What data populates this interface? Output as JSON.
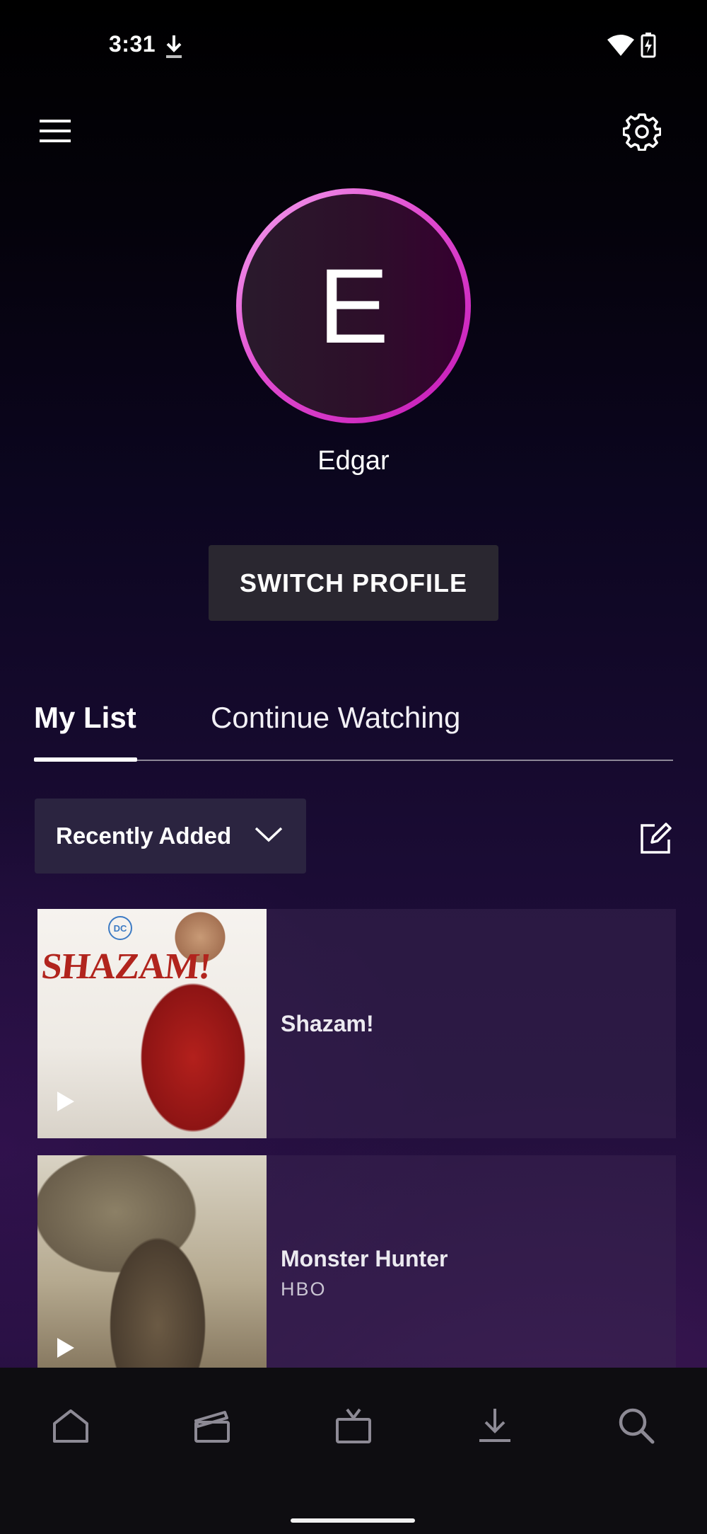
{
  "status_bar": {
    "time": "3:31",
    "icons": [
      "download-status-icon",
      "wifi-icon",
      "battery-charging-icon"
    ]
  },
  "header": {
    "menu_icon": "hamburger-menu-icon",
    "settings_icon": "gear-icon"
  },
  "profile": {
    "initial": "E",
    "name": "Edgar",
    "switch_button_label": "SWITCH PROFILE",
    "ring_color": "#e04cd0"
  },
  "tabs": [
    {
      "label": "My List",
      "active": true
    },
    {
      "label": "Continue Watching",
      "active": false
    }
  ],
  "sort": {
    "selected": "Recently Added",
    "icon": "chevron-down-icon"
  },
  "edit_icon": "edit-icon",
  "list_items": [
    {
      "title": "Shazam!",
      "subtitle": "",
      "poster_text": "SHAZAM!",
      "poster_logo": "DC"
    },
    {
      "title": "Monster Hunter",
      "subtitle": "HBO"
    }
  ],
  "bottom_nav": [
    {
      "name": "home",
      "icon": "home-icon"
    },
    {
      "name": "movies",
      "icon": "clapperboard-icon"
    },
    {
      "name": "series",
      "icon": "tv-icon"
    },
    {
      "name": "downloads",
      "icon": "download-icon"
    },
    {
      "name": "search",
      "icon": "search-icon"
    }
  ]
}
